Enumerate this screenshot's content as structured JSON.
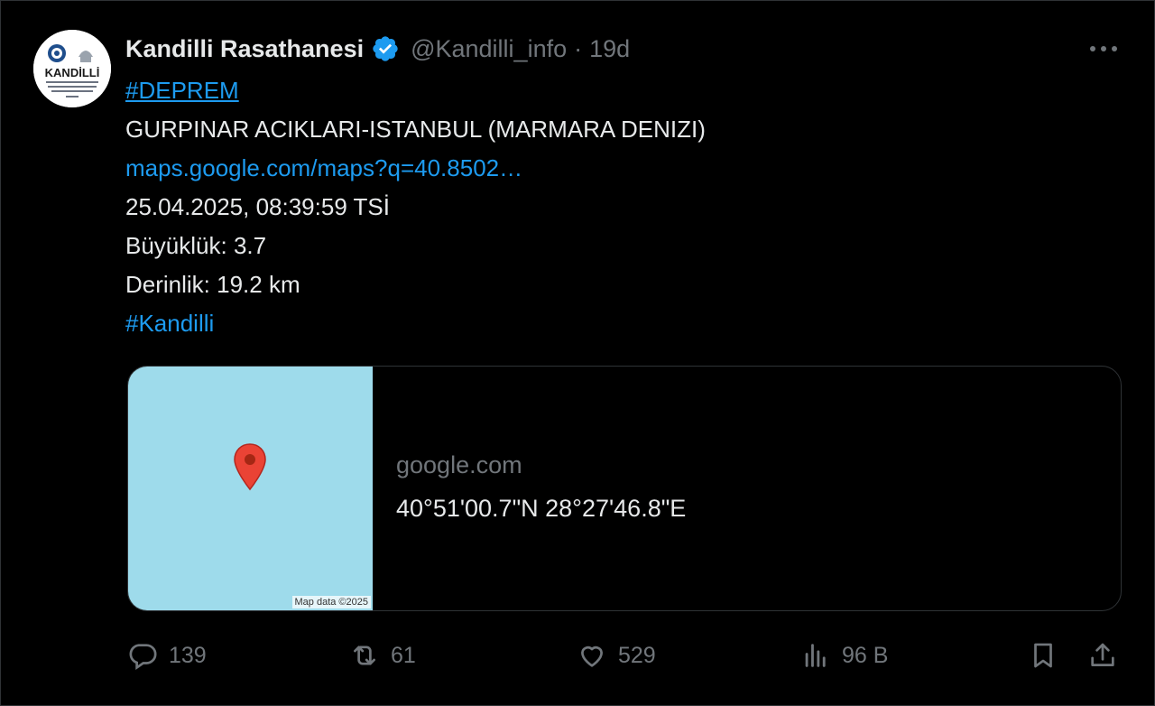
{
  "tweet": {
    "author": {
      "display_name": "Kandilli Rasathanesi",
      "handle": "@Kandilli_info",
      "avatar_text": "KANDİLLİ",
      "verified": true
    },
    "separator": "·",
    "time": "19d",
    "lines": {
      "hashtag1": "#DEPREM",
      "location": "GURPINAR ACIKLARI-ISTANBUL (MARMARA DENIZI)",
      "link": "maps.google.com/maps?q=40.8502…",
      "datetime": "25.04.2025, 08:39:59 TSİ",
      "magnitude": "Büyüklük: 3.7",
      "depth": "Derinlik: 19.2 km",
      "hashtag2": "#Kandilli"
    },
    "card": {
      "domain": "google.com",
      "title": "40°51'00.7\"N 28°27'46.8\"E",
      "map_attribution": "Map data ©2025"
    },
    "actions": {
      "replies": "139",
      "reposts": "61",
      "likes": "529",
      "views": "96 B"
    }
  },
  "colors": {
    "background": "#000000",
    "text": "#e7e9ea",
    "muted": "#71767b",
    "link": "#1d9bf0",
    "border": "#2f3336",
    "map_water": "#9edbeb",
    "pin": "#ea4335"
  }
}
